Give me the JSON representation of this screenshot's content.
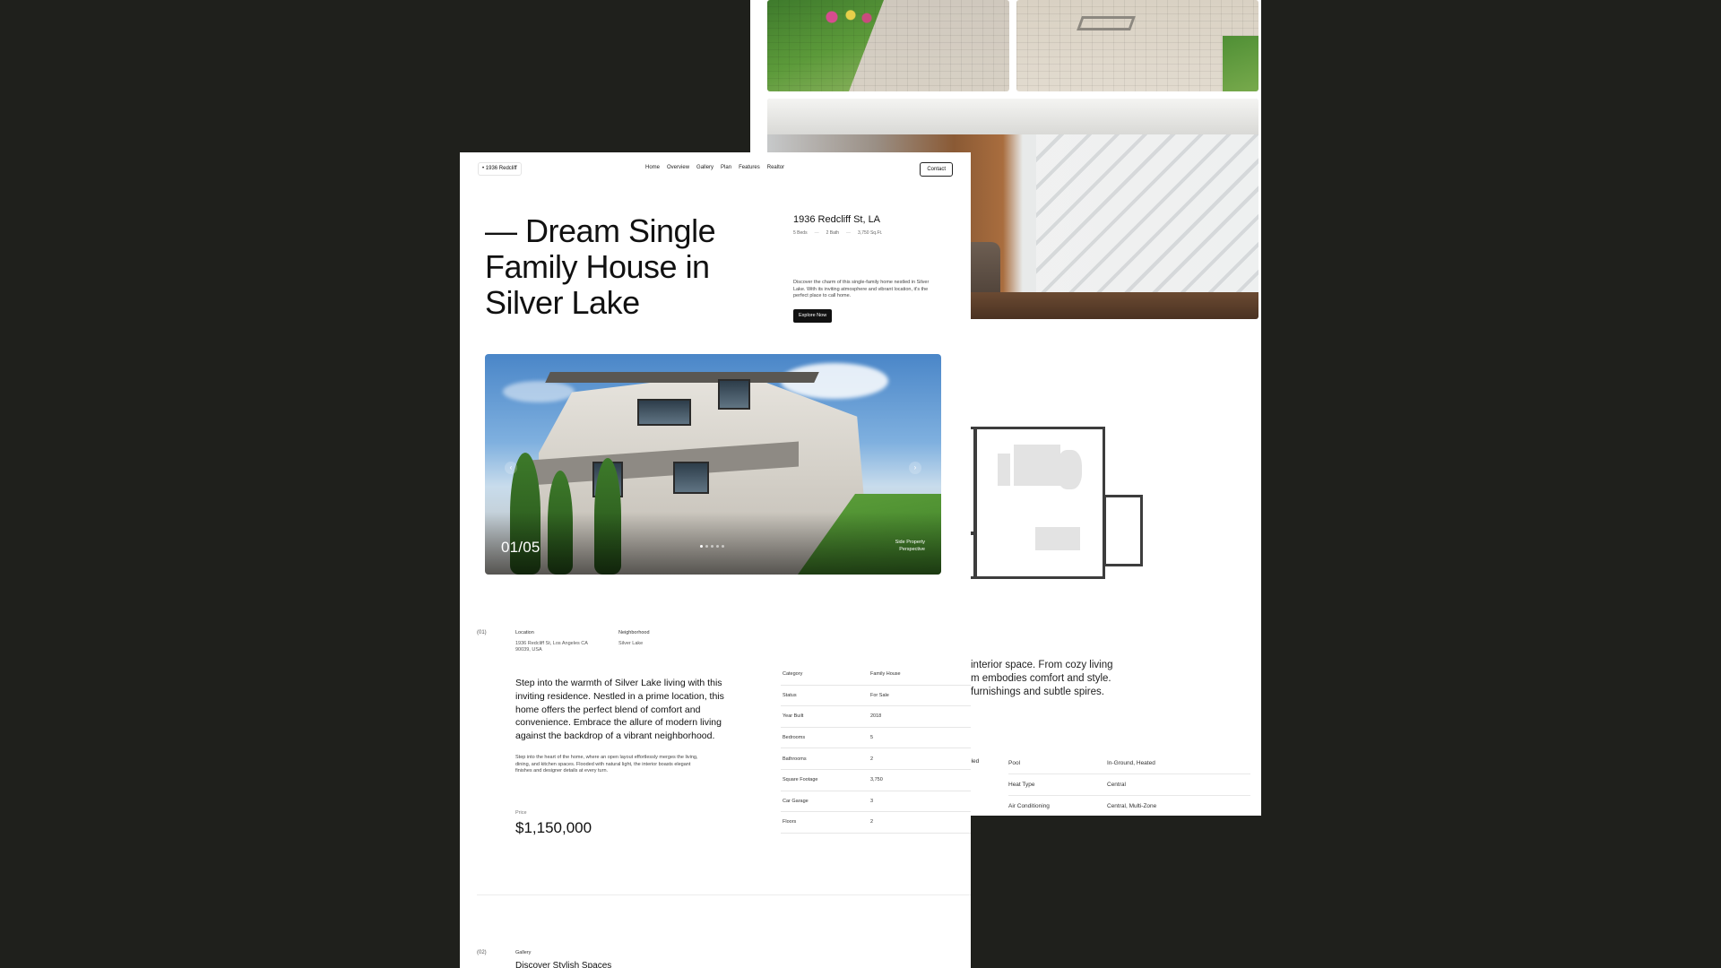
{
  "nav": {
    "brand": "• 1936 Redcliff",
    "links": [
      "Home",
      "Overview",
      "Gallery",
      "Plan",
      "Features",
      "Realtor"
    ],
    "contact": "Contact"
  },
  "hero": {
    "title": "— Dream Single Family House in Silver Lake",
    "address": "1936 Redcliff St, LA",
    "beds": "5 Beds",
    "baths": "2 Bath",
    "area": "3,750 Sq.Ft.",
    "description": "Discover the charm of this single-family home nestled in Silver Lake. With its inviting atmosphere and vibrant location, it's the perfect place to call home.",
    "cta": "Explore Now",
    "slide_counter": "01/05",
    "slide_caption": "Side Property Perspective"
  },
  "overview": {
    "section_number": "(01)",
    "location_label": "Location",
    "location_value": "1936 Redcliff St, Los Angeles CA 90039, USA",
    "neighborhood_label": "Neighborhood",
    "neighborhood_value": "Silver Lake",
    "intro": "Step into the warmth of Silver Lake living with this inviting residence. Nestled in a prime location, this home offers the perfect blend of comfort and convenience. Embrace the allure of modern living against the backdrop of a vibrant neighborhood.",
    "intro_sub": "Step into the heart of the home, where an open layout effortlessly merges the living, dining, and kitchen spaces. Flooded with natural light, the interior boasts elegant finishes and designer details at every turn.",
    "price_label": "Price",
    "price": "$1,150,000",
    "specs": [
      {
        "label": "Category",
        "value": "Family House"
      },
      {
        "label": "Status",
        "value": "For Sale"
      },
      {
        "label": "Year Built",
        "value": "2018"
      },
      {
        "label": "Bedrooms",
        "value": "5"
      },
      {
        "label": "Bathrooms",
        "value": "2"
      },
      {
        "label": "Square Footage",
        "value": "3,750"
      },
      {
        "label": "Car Garage",
        "value": "3"
      },
      {
        "label": "Floors",
        "value": "2"
      }
    ]
  },
  "gallery": {
    "section_number": "(02)",
    "label": "Gallery",
    "title": "Discover Stylish Spaces"
  },
  "back_page": {
    "text": "interior space. From cozy living m embodies comfort and style. furnishings and subtle spires.",
    "left_label": "eled",
    "specs": [
      {
        "label": "Pool",
        "value": "In-Ground, Heated"
      },
      {
        "label": "Heat Type",
        "value": "Central"
      },
      {
        "label": "Air Conditioning",
        "value": "Central, Multi-Zone"
      }
    ]
  },
  "colors": {
    "background": "#1f201c",
    "page": "#ffffff",
    "accent": "#111111"
  }
}
